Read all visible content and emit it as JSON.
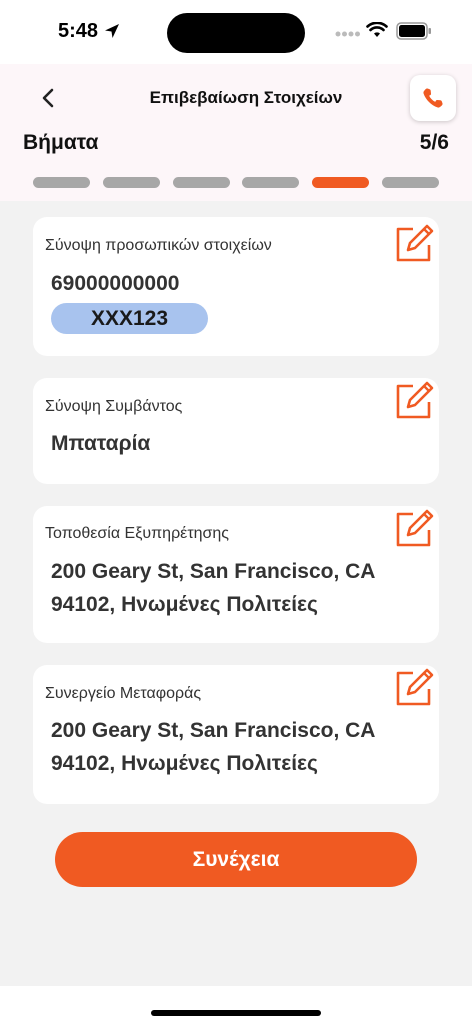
{
  "status_bar": {
    "time": "5:48"
  },
  "header": {
    "title": "Επιβεβαίωση Στοιχείων",
    "steps_label": "Βήματα",
    "steps_count": "5/6"
  },
  "progress": {
    "total_steps": 6,
    "current_step": 5,
    "active_color": "#f05a22",
    "inactive_color": "#a7a7a7"
  },
  "cards": {
    "personal": {
      "label": "Σύνοψη προσωπικών στοιχείων",
      "phone": "69000000000",
      "plate": "XXX123"
    },
    "incident": {
      "label": "Σύνοψη Συμβάντος",
      "value": "Μπαταρία"
    },
    "location": {
      "label": "Τοποθεσία Εξυπηρέτησης",
      "line1": "200 Geary St, San Francisco, CA",
      "line2": "94102, Ηνωμένες Πολιτείες"
    },
    "workshop": {
      "label": "Συνεργείο Μεταφοράς",
      "line1": "200 Geary St, San Francisco, CA",
      "line2": "94102, Ηνωμένες Πολιτείες"
    }
  },
  "actions": {
    "continue_label": "Συνέχεια"
  },
  "colors": {
    "accent": "#f05a22",
    "plate_badge": "#a8c3ee",
    "header_bg": "#fdf6f9"
  }
}
